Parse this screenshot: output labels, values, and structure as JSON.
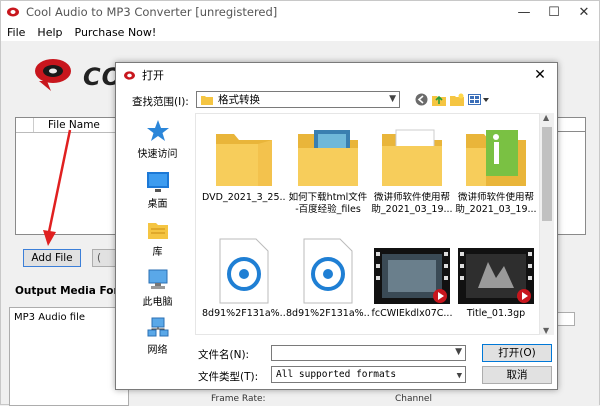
{
  "window": {
    "title": "Cool Audio to MP3 Converter  [unregistered]"
  },
  "menu": [
    "File",
    "Help",
    "Purchase Now!"
  ],
  "logo_text": "COO",
  "file_list": {
    "column_header": "File Name"
  },
  "buttons": {
    "add_file": "Add File",
    "second": "("
  },
  "output": {
    "label": "Output Media Format",
    "selected_format": "MP3 Audio file"
  },
  "bottom_strip": {
    "left": "Frame Rate:",
    "right": "Channel"
  },
  "dialog": {
    "title": "打开",
    "look_in_label": "查找范围(I):",
    "look_in_value": "格式转换",
    "places": [
      {
        "label": "快速访问",
        "icon": "star-icon"
      },
      {
        "label": "桌面",
        "icon": "desktop-icon"
      },
      {
        "label": "库",
        "icon": "library-icon"
      },
      {
        "label": "此电脑",
        "icon": "computer-icon"
      },
      {
        "label": "网络",
        "icon": "network-icon"
      }
    ],
    "files": [
      {
        "name": "DVD_2021_3_25...",
        "icon": "folder-icon"
      },
      {
        "name": "如何下载html文件",
        "name2": "-百度经验_files",
        "icon": "folder-icon"
      },
      {
        "name": "微讲师软件使用帮",
        "name2": "助_2021_03_19...",
        "icon": "folder-icon"
      },
      {
        "name": "微讲师软件使用帮",
        "name2": "助_2021_03_19...",
        "icon": "folder-icon"
      },
      {
        "name": "8d91%2F131a%...",
        "icon": "audio-file-icon"
      },
      {
        "name": "8d91%2F131a%...",
        "icon": "audio-file-icon"
      },
      {
        "name": "fcCWIEkdlx07C...",
        "icon": "video-file-icon"
      },
      {
        "name": "Title_01.3gp",
        "icon": "video-file-icon"
      }
    ],
    "filename_label": "文件名(N):",
    "filename_value": "",
    "filetype_label": "文件类型(T):",
    "filetype_value": "All supported formats",
    "open_button": "打开(O)",
    "cancel_button": "取消"
  },
  "colors": {
    "arrow": "#e02020",
    "folder": "#f5c542",
    "accent_blue": "#0078d7",
    "logo_red": "#c8161d"
  }
}
